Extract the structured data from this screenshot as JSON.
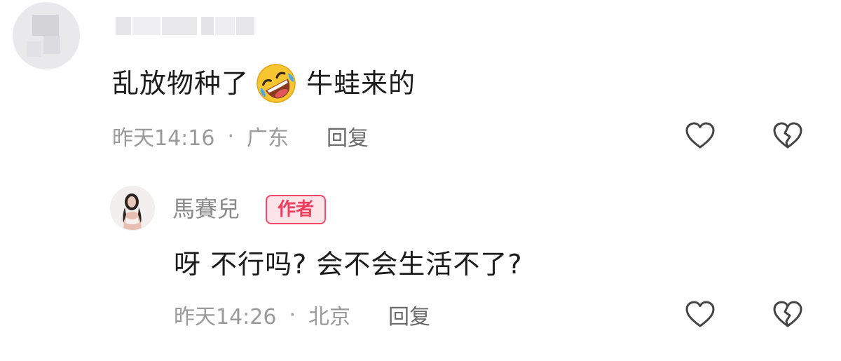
{
  "comment": {
    "text_before_emoji": "乱放物种了",
    "emoji": "rolling-on-floor-laughing-emoji",
    "text_after_emoji": "牛蛙来的",
    "time": "昨天14:16",
    "separator": "·",
    "location": "广东",
    "reply_label": "回复",
    "like_icon": "heart-icon",
    "dislike_icon": "broken-heart-icon"
  },
  "reply": {
    "username": "馬賽兒",
    "badge": "作者",
    "text": "呀 不行吗? 会不会生活不了?",
    "time": "昨天14:26",
    "separator": "·",
    "location": "北京",
    "reply_label": "回复",
    "like_icon": "heart-icon",
    "dislike_icon": "broken-heart-icon"
  },
  "colors": {
    "badge_text": "#ee3e5f",
    "badge_bg": "#fde4e8",
    "meta_text": "#9a9a9a",
    "body_text": "#1c1c1c"
  }
}
